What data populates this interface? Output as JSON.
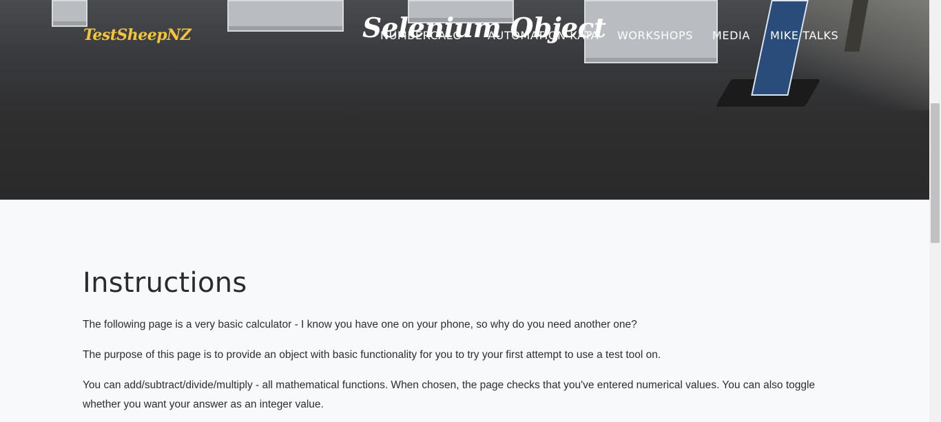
{
  "brand": {
    "logo_text": "TestSheepNZ"
  },
  "nav": {
    "items": [
      {
        "label": "NUMBERCALC"
      },
      {
        "label": "AUTOMATION KATA"
      },
      {
        "label": "WORKSHOPS"
      },
      {
        "label": "MEDIA"
      },
      {
        "label": "MIKE TALKS"
      }
    ]
  },
  "hero": {
    "title": "Selenium Object"
  },
  "instructions": {
    "heading": "Instructions",
    "paragraphs": [
      "The following page is a very basic calculator - I know you have one on your phone, so why do you need another one?",
      "The purpose of this page is to provide an object with basic functionality for you to try your first attempt to use a test tool on.",
      "You can add/subtract/divide/multiply - all mathematical functions. When chosen, the page checks that you've entered numerical values. You can also toggle whether you want your answer as an integer value."
    ]
  },
  "colors": {
    "logo": "#f2c53d",
    "page_background": "#f8f9fb",
    "text": "#2d2d2d"
  }
}
